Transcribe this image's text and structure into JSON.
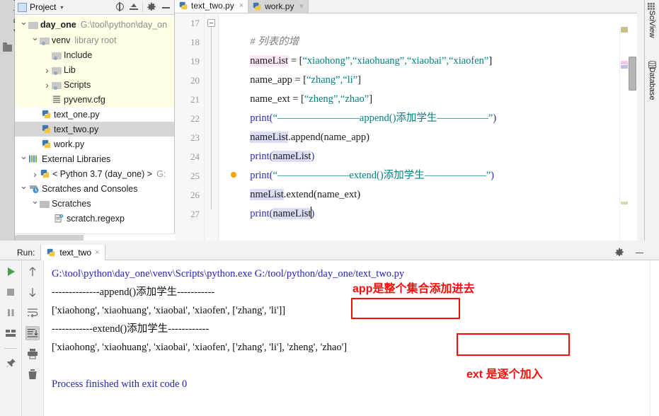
{
  "window": {
    "left_rail_tab": "1: Project",
    "right_rail_tabs": [
      "SciView",
      "Database"
    ]
  },
  "project_panel": {
    "title": "Project",
    "caret": "▾",
    "icons": [
      "locate-icon",
      "collapse-all-icon",
      "settings-gear-icon",
      "minimize-icon"
    ],
    "tree": [
      {
        "label": "day_one",
        "sub": "G:\\tool\\python\\day_on",
        "icon": "folder-icon",
        "arrow": "down",
        "depth": 0,
        "bold": true,
        "highlight": "yellow"
      },
      {
        "label": "venv",
        "sub": "library root",
        "icon": "folder-module-icon",
        "arrow": "down",
        "depth": 1,
        "bold": false,
        "highlight": "yellow"
      },
      {
        "label": "Include",
        "sub": "",
        "icon": "folder-module-icon",
        "arrow": "none",
        "depth": 2,
        "bold": false,
        "highlight": "yellow"
      },
      {
        "label": "Lib",
        "sub": "",
        "icon": "folder-module-icon",
        "arrow": "right",
        "depth": 2,
        "bold": false,
        "highlight": "yellow"
      },
      {
        "label": "Scripts",
        "sub": "",
        "icon": "folder-module-icon",
        "arrow": "right",
        "depth": 2,
        "bold": false,
        "highlight": "yellow"
      },
      {
        "label": "pyvenv.cfg",
        "sub": "",
        "icon": "config-file-icon",
        "arrow": "none",
        "depth": 2,
        "bold": false,
        "highlight": "yellow"
      },
      {
        "label": "text_one.py",
        "sub": "",
        "icon": "python-file-icon",
        "arrow": "none",
        "depth": 1,
        "bold": false,
        "highlight": "none"
      },
      {
        "label": "text_two.py",
        "sub": "",
        "icon": "python-file-icon",
        "arrow": "none",
        "depth": 1,
        "bold": false,
        "highlight": "selected"
      },
      {
        "label": "work.py",
        "sub": "",
        "icon": "python-file-icon",
        "arrow": "none",
        "depth": 1,
        "bold": false,
        "highlight": "none"
      },
      {
        "label": "External Libraries",
        "sub": "",
        "icon": "external-libraries-icon",
        "arrow": "down",
        "depth": 0,
        "bold": false,
        "highlight": "none"
      },
      {
        "label": "< Python 3.7 (day_one) >",
        "sub": "G:",
        "icon": "python-sdk-icon",
        "arrow": "right",
        "depth": 1,
        "bold": false,
        "highlight": "none"
      },
      {
        "label": "Scratches and Consoles",
        "sub": "",
        "icon": "scratches-icon",
        "arrow": "down",
        "depth": 0,
        "bold": false,
        "highlight": "none"
      },
      {
        "label": "Scratches",
        "sub": "",
        "icon": "folder-icon",
        "arrow": "down",
        "depth": 1,
        "bold": false,
        "highlight": "none"
      },
      {
        "label": "scratch.regexp",
        "sub": "",
        "icon": "scratch-file-icon",
        "arrow": "none",
        "depth": 2,
        "bold": false,
        "highlight": "none"
      }
    ]
  },
  "editor": {
    "tabs": [
      {
        "label": "text_two.py",
        "icon": "python-file-icon",
        "active": true,
        "close": "×"
      },
      {
        "label": "work.py",
        "icon": "python-file-icon",
        "active": false,
        "close": "×"
      }
    ],
    "first_line_number": 17,
    "current_line": 26,
    "lines": [
      {
        "n": 17,
        "text": "# 列表的增"
      },
      {
        "n": 18,
        "text": "nameList = [“xiaohong”,“xiaohuang”,“xiaobai”,“xiaofen”]"
      },
      {
        "n": 19,
        "text": "name_app = [“zhang”,“li”]"
      },
      {
        "n": 20,
        "text": "name_ext = [“zheng”,“zhao”]"
      },
      {
        "n": 21,
        "text": "print(“--------------append()添加学生-----------”)"
      },
      {
        "n": 22,
        "text": "nameList.append(name_app)"
      },
      {
        "n": 23,
        "text": "print(nameList)"
      },
      {
        "n": 24,
        "text": "print(“------------extend()添加学生------------”)"
      },
      {
        "n": 25,
        "text": "nameList.extend(name_ext)"
      },
      {
        "n": 26,
        "text": "print(nameList)"
      },
      {
        "n": 27,
        "text": ""
      }
    ],
    "fragments": {
      "l17_comment": "# 列表的增",
      "l18_var": "nameList",
      "l18_rest_a": " = [",
      "l18_str": "“xiaohong”,“xiaohuang”,“xiaobai”,“xiaofen”",
      "l18_rest_b": "]",
      "l19_var": "name_app = [",
      "l19_str": "“zhang”,“li”",
      "l19_end": "]",
      "l20_var": "name_ext = [",
      "l20_str": "“zheng”,“zhao”",
      "l20_end": "]",
      "l21_fn": "print(",
      "l21_str": "“————————append()添加学生—————”",
      "l21_end": ")",
      "l22_var": "nameList",
      "l22_rest": ".append(name_app)",
      "l23_fn": "print(",
      "l23_var": "nameList",
      "l23_end": ")",
      "l24_fn": "print(",
      "l24_str": "“———————extend()添加学生——————”",
      "l24_end": ")",
      "l25_var_a": "n",
      "l25_var_b": "meList",
      "l25_rest": ".extend(name_ext)",
      "l26_fn": "print(",
      "l26_var": "nameList",
      "l26_end": ")"
    },
    "colors": {
      "string": "#008080",
      "comment": "#808080",
      "function": "#2b2bbd",
      "highlight_pink": "#ffe6f5",
      "highlight_blue": "#dcdcf5",
      "current_line_bg": "#fdf6e3"
    }
  },
  "run_panel": {
    "label": "Run:",
    "tab_label": "text_two",
    "tab_icon": "python-file-icon",
    "tab_close": "×",
    "header_icons": [
      "settings-gear-icon",
      "minimize-icon"
    ],
    "left_tools": [
      "run-icon",
      "stop-icon",
      "pause-icon",
      "restore-layout-icon",
      "pin-icon"
    ],
    "right_tools": [
      "up-arrow-icon",
      "down-arrow-icon",
      "soft-wrap-icon",
      "scroll-to-end-icon",
      "print-icon",
      "trash-icon"
    ],
    "console_lines": [
      {
        "text": "G:\\tool\\python\\day_one\\venv\\Scripts\\python.exe G:/tool/python/day_one/text_two.py",
        "style": "path"
      },
      {
        "text": "--------------append()添加学生-----------",
        "style": "plain"
      },
      {
        "text": "['xiaohong', 'xiaohuang', 'xiaobai', 'xiaofen', ['zhang', 'li']]",
        "style": "plain"
      },
      {
        "text": "------------extend()添加学生------------",
        "style": "plain"
      },
      {
        "text": "['xiaohong', 'xiaohuang', 'xiaobai', 'xiaofen', ['zhang', 'li'], 'zheng', 'zhao']",
        "style": "plain"
      },
      {
        "text": "",
        "style": "plain"
      },
      {
        "text": "Process finished with exit code 0",
        "style": "finish"
      }
    ],
    "annotations": [
      {
        "text": "app是整个集合添加进去",
        "color": "#fb0b0b"
      },
      {
        "text": "ext 是逐个加入",
        "color": "#fb0b0b"
      }
    ],
    "annotation_boxes": 2
  }
}
